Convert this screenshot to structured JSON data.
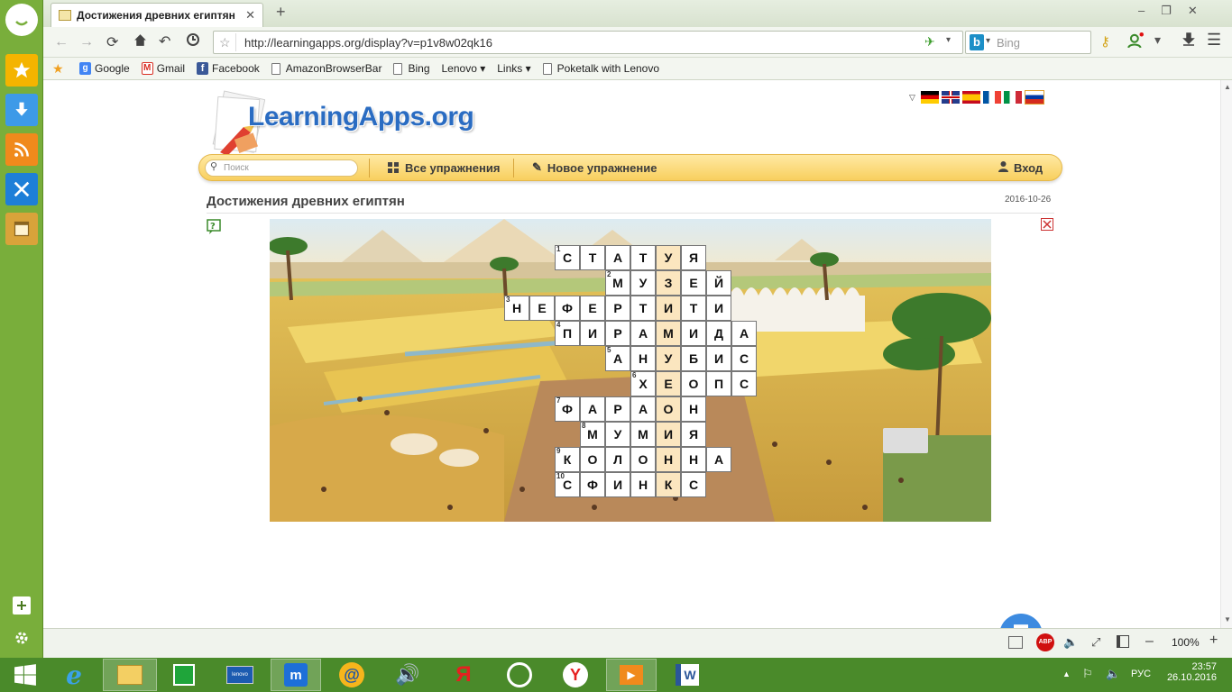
{
  "browser": {
    "tab_title": "Достижения древних египтян",
    "new_tab_label": "+",
    "address": "http://learningapps.org/display?v=p1v8w02qk16",
    "search_placeholder": "Bing",
    "bookmarks": [
      {
        "label": "Google",
        "color": "#4285f4"
      },
      {
        "label": "Gmail",
        "color": "#d93025"
      },
      {
        "label": "Facebook",
        "color": "#3b5998"
      },
      {
        "label": "AmazonBrowserBar",
        "color": ""
      },
      {
        "label": "Bing",
        "color": ""
      },
      {
        "label": "Lenovo ▾",
        "color": ""
      },
      {
        "label": "Links ▾",
        "color": ""
      },
      {
        "label": "Poketalk with Lenovo",
        "color": ""
      }
    ],
    "zoom": "100%"
  },
  "page": {
    "logo": "LearningApps.org",
    "search_placeholder": "Поиск",
    "nav": {
      "all_exercises": "Все упражнения",
      "new_exercise": "Новое упражнение",
      "login": "Вход"
    },
    "title": "Достижения древних египтян",
    "date": "2016-10-26",
    "languages": [
      "de",
      "en",
      "es",
      "fr",
      "it",
      "ru"
    ]
  },
  "crossword": {
    "solution_column": 4,
    "rows": [
      {
        "num": "1",
        "start": 0,
        "letters": [
          "С",
          "Т",
          "А",
          "Т",
          "У",
          "Я"
        ]
      },
      {
        "num": "2",
        "start": 2,
        "letters": [
          "М",
          "У",
          "З",
          "Е",
          "Й"
        ]
      },
      {
        "num": "3",
        "start": -2,
        "letters": [
          "Н",
          "Е",
          "Ф",
          "Е",
          "Р",
          "Т",
          "И",
          "Т",
          "И"
        ]
      },
      {
        "num": "4",
        "start": 0,
        "letters": [
          "П",
          "И",
          "Р",
          "А",
          "М",
          "И",
          "Д",
          "А"
        ]
      },
      {
        "num": "5",
        "start": 2,
        "letters": [
          "А",
          "Н",
          "У",
          "Б",
          "И",
          "С"
        ]
      },
      {
        "num": "6",
        "start": 3,
        "letters": [
          "Х",
          "Е",
          "О",
          "П",
          "С"
        ]
      },
      {
        "num": "7",
        "start": 0,
        "letters": [
          "Ф",
          "А",
          "Р",
          "А",
          "О",
          "Н"
        ]
      },
      {
        "num": "8",
        "start": 1,
        "letters": [
          "М",
          "У",
          "М",
          "И",
          "Я"
        ]
      },
      {
        "num": "9",
        "start": 0,
        "letters": [
          "К",
          "О",
          "Л",
          "О",
          "Н",
          "Н",
          "А"
        ]
      },
      {
        "num": "10",
        "start": 0,
        "letters": [
          "С",
          "Ф",
          "И",
          "Н",
          "К",
          "С"
        ]
      }
    ]
  },
  "taskbar": {
    "lang": "РУС",
    "time": "23:57",
    "date": "26.10.2016"
  }
}
